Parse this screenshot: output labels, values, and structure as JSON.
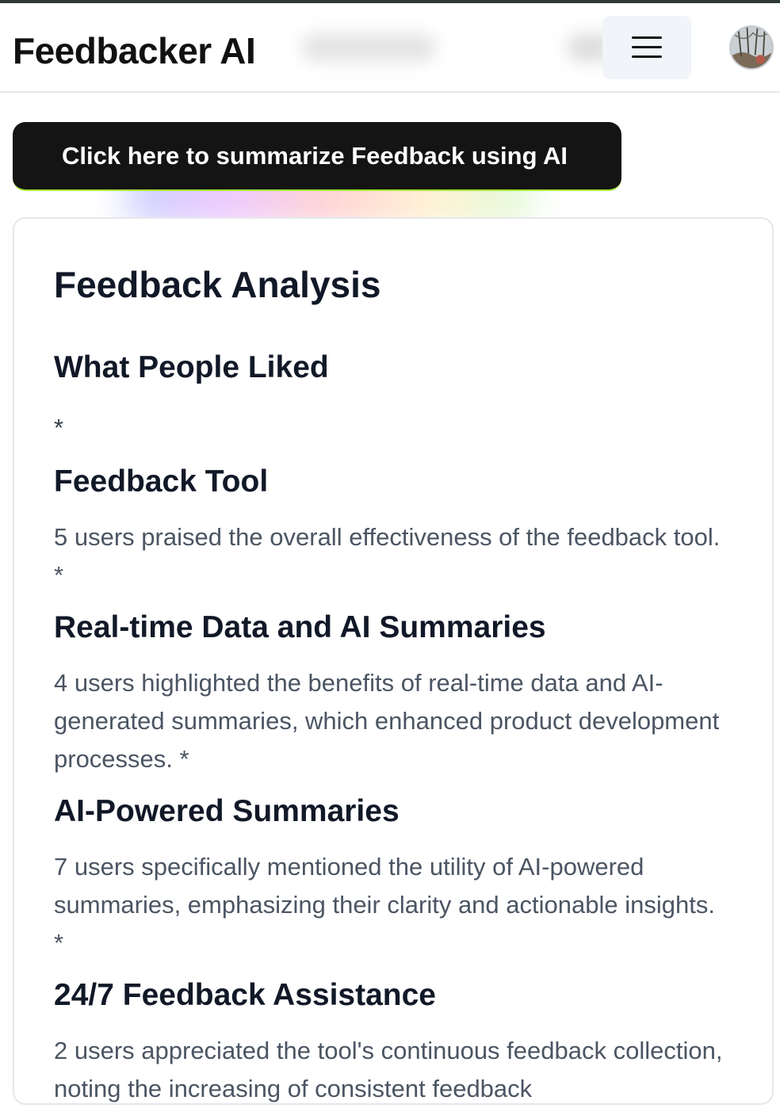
{
  "header": {
    "brand": "Feedbacker AI",
    "menu_icon": "hamburger-menu-icon",
    "avatar_icon": "user-avatar"
  },
  "cta": {
    "label": "Click here to summarize Feedback using AI"
  },
  "analysis": {
    "title": "Feedback Analysis",
    "section_title": "What People Liked",
    "bullet": "*",
    "items": [
      {
        "heading": "Feedback Tool",
        "text": "5 users praised the overall effectiveness of the feedback tool. *"
      },
      {
        "heading": "Real-time Data and AI Summaries",
        "text": "4 users highlighted the benefits of real-time data and AI-generated summaries, which enhanced product development processes. *"
      },
      {
        "heading": "AI-Powered Summaries",
        "text": "7 users specifically mentioned the utility of AI-powered summaries, emphasizing their clarity and actionable insights. *"
      },
      {
        "heading": "24/7 Feedback Assistance",
        "text": "2 users appreciated the tool's continuous feedback collection, noting the increasing of consistent feedback"
      }
    ]
  }
}
